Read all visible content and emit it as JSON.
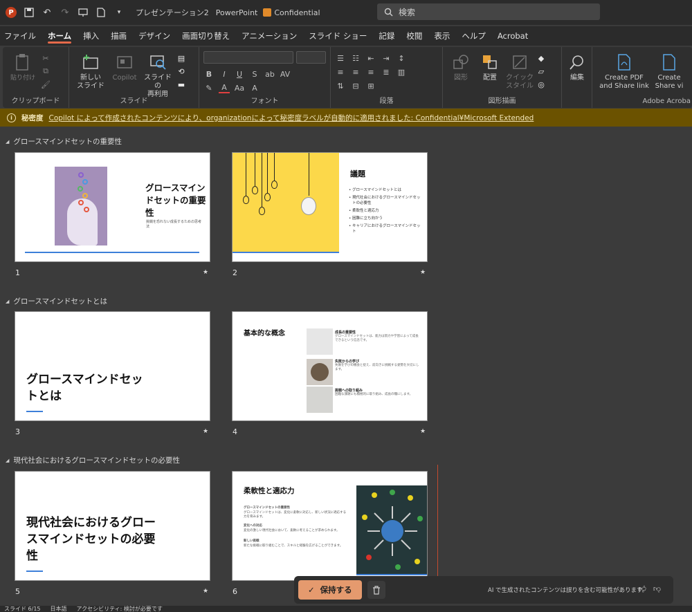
{
  "titlebar": {
    "doc_title": "プレゼンテーション2",
    "app_name": "PowerPoint",
    "sensitivity": "Confidential",
    "search_placeholder": "検索"
  },
  "tabs": [
    {
      "label": "ファイル",
      "active": false
    },
    {
      "label": "ホーム",
      "active": true
    },
    {
      "label": "挿入",
      "active": false
    },
    {
      "label": "描画",
      "active": false
    },
    {
      "label": "デザイン",
      "active": false
    },
    {
      "label": "画面切り替え",
      "active": false
    },
    {
      "label": "アニメーション",
      "active": false
    },
    {
      "label": "スライド ショー",
      "active": false
    },
    {
      "label": "記録",
      "active": false
    },
    {
      "label": "校閲",
      "active": false
    },
    {
      "label": "表示",
      "active": false
    },
    {
      "label": "ヘルプ",
      "active": false
    },
    {
      "label": "Acrobat",
      "active": false
    }
  ],
  "ribbon": {
    "clipboard": {
      "label": "クリップボード",
      "paste": "貼り付け"
    },
    "slides": {
      "label": "スライド",
      "new_slide": "新しい\nスライド",
      "copilot": "Copilot",
      "reuse": "スライドの\n再利用"
    },
    "font": {
      "label": "フォント"
    },
    "paragraph": {
      "label": "段落"
    },
    "drawing": {
      "label": "図形描画",
      "shapes": "図形",
      "arrange": "配置",
      "quick_styles": "クイック\nスタイル"
    },
    "editing": {
      "label": "編集"
    },
    "adobe": {
      "label": "Adobe Acroba",
      "create_pdf": "Create PDF\nand Share link",
      "create2": "Create\nShare vi"
    }
  },
  "notice": {
    "label": "秘密度",
    "message": "Copilot によって作成されたコンテンツにより、organizationによって秘密度ラベルが自動的に適用されました: Confidential¥Microsoft Extended"
  },
  "sections": [
    {
      "title": "グロースマインドセットの重要性"
    },
    {
      "title": "グロースマインドセットとは"
    },
    {
      "title": "現代社会におけるグロースマインドセットの必要性"
    }
  ],
  "slides": {
    "s1": {
      "num": "1",
      "title": "グロースマインドセットの重要性",
      "sub": "挑戦を恐れない成長するための思考法"
    },
    "s2": {
      "num": "2",
      "title": "議題",
      "items": [
        "グロースマインドセットとは",
        "現代社会におけるグロースマインドセットの必要性",
        "柔軟性と適応力",
        "困難に立ち向かう",
        "キャリアにおけるグロースマインドセット"
      ]
    },
    "s3": {
      "num": "3",
      "title": "グロースマインドセットとは"
    },
    "s4": {
      "num": "4",
      "title": "基本的な概念",
      "items": [
        {
          "head": "成長の重要性",
          "desc": "グロースマインドセットは、能力は努力や学習によって成長できるという信念です。"
        },
        {
          "head": "失敗からの学び",
          "desc": "失敗を学びの機会と捉え、前向きに挑戦する姿勢を大切にします。"
        },
        {
          "head": "挑戦への取り組み",
          "desc": "困難な課題にも積極的に取り組み、成長の糧にします。"
        }
      ]
    },
    "s5": {
      "num": "5",
      "title": "現代社会におけるグロースマインドセットの必要性"
    },
    "s6": {
      "num": "6",
      "title": "柔軟性と適応力",
      "paras": [
        {
          "head": "グロースマインドセットの重要性",
          "desc": "グロースマインドセットは、変化に柔軟に対応し、新しい状況に適応する力を育みます。"
        },
        {
          "head": "変化への対応",
          "desc": "変化の激しい現代社会において、柔軟に考えることが求められます。"
        },
        {
          "head": "新しい挑戦",
          "desc": "新たな挑戦に取り組むことで、スキルと経験を広げることができます。"
        }
      ]
    }
  },
  "actionbar": {
    "keep_label": "保持する",
    "ai_note": "AI で生成されたコンテンツは誤りを含む可能性があります。"
  },
  "statusbar": {
    "slide_count": "スライド 6/15",
    "language": "日本語",
    "accessibility": "アクセシビリティ: 検討が必要です"
  }
}
